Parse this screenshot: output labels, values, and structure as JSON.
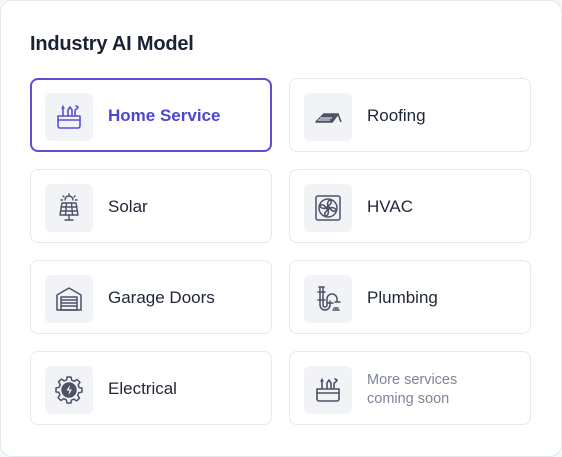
{
  "title": "Industry AI Model",
  "accent_color": "#5b4fd6",
  "services": [
    {
      "label": "Home Service",
      "icon": "toolbox-icon",
      "selected": true
    },
    {
      "label": "Roofing",
      "icon": "roof-icon",
      "selected": false
    },
    {
      "label": "Solar",
      "icon": "solar-panel-icon",
      "selected": false
    },
    {
      "label": "HVAC",
      "icon": "fan-icon",
      "selected": false
    },
    {
      "label": "Garage Doors",
      "icon": "garage-door-icon",
      "selected": false
    },
    {
      "label": "Plumbing",
      "icon": "pipe-icon",
      "selected": false
    },
    {
      "label": "Electrical",
      "icon": "electric-gear-icon",
      "selected": false
    }
  ],
  "more": {
    "line1": "More services",
    "line2": "coming soon",
    "icon": "toolbox-icon"
  }
}
